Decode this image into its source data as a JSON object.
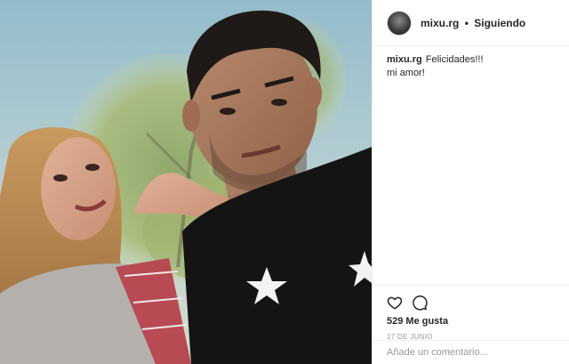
{
  "post": {
    "username": "mixu.rg",
    "separator": "•",
    "follow_status": "Siguiendo",
    "caption_user": "mixu.rg",
    "caption_line1": "Felicidades!!!",
    "caption_line2": "mi amor!",
    "likes": "529 Me gusta",
    "date": "17 de junio",
    "comment_placeholder": "Añade un comentario...",
    "photo_alt": "Selfie de una pareja al aire libre bajo un árbol"
  },
  "icons": {
    "like": "heart-icon",
    "comment": "comment-icon"
  },
  "colors": {
    "text": "#262626",
    "muted": "#999999",
    "border": "#efefef"
  }
}
